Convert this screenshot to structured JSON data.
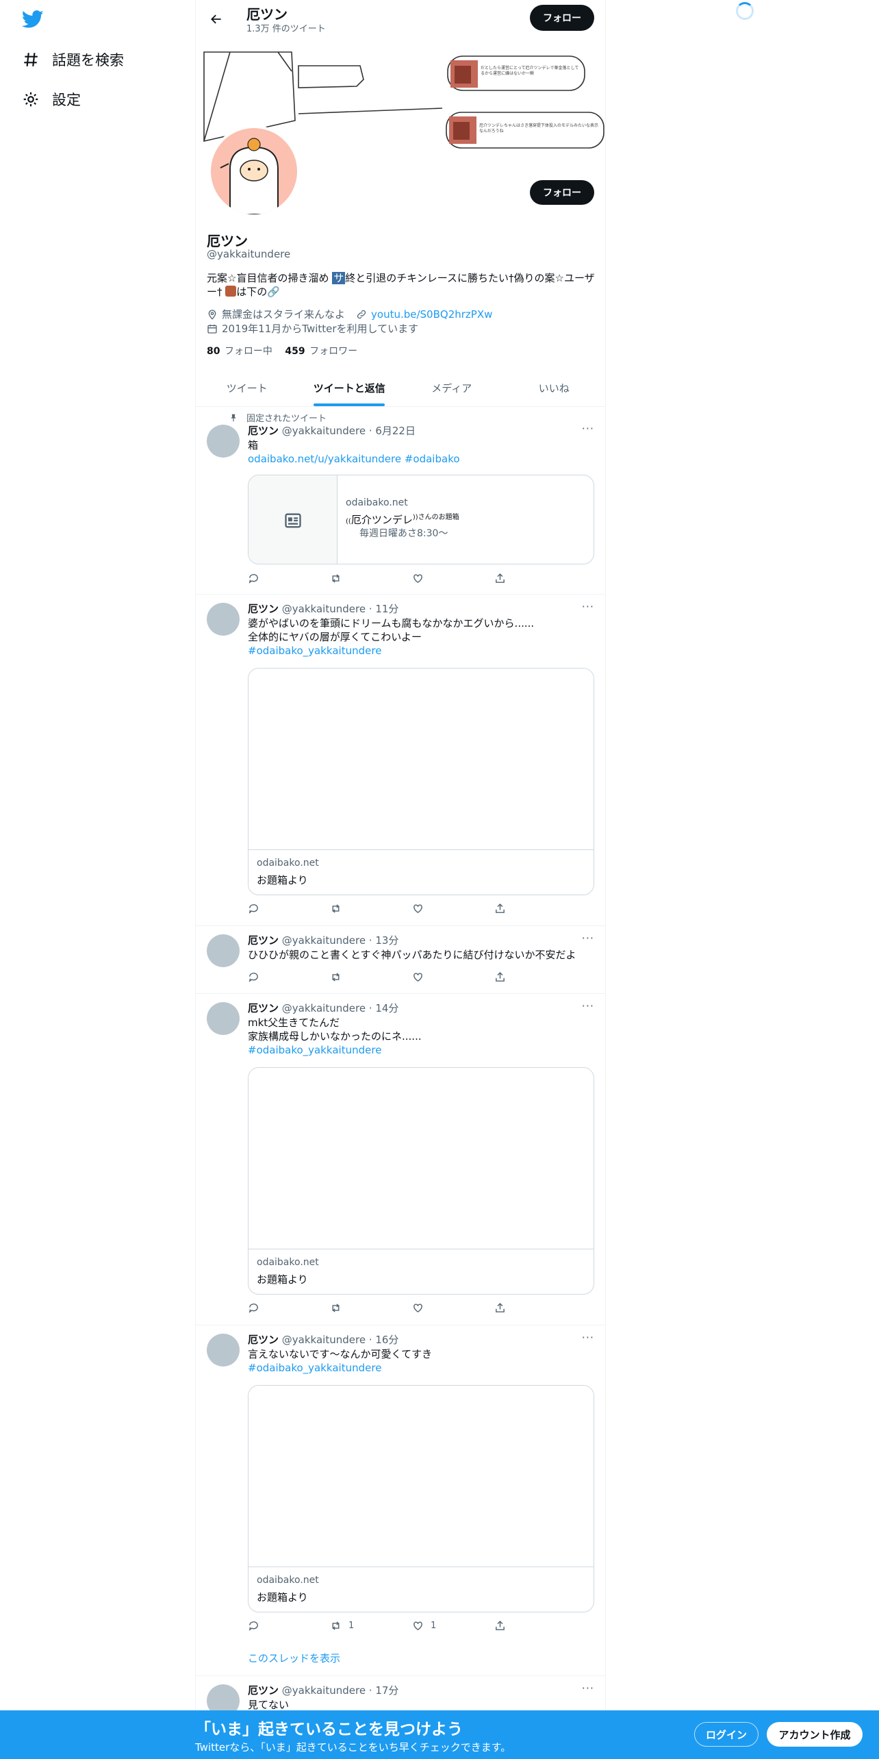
{
  "nav": {
    "items": [
      {
        "label": "話題を検索",
        "icon": "hashtag-icon"
      },
      {
        "label": "設定",
        "icon": "gear-icon"
      }
    ]
  },
  "header": {
    "name": "厄ツン",
    "tweet_count": "1.3万 件のツイート",
    "follow_label": "フォロー"
  },
  "profile": {
    "name": "厄ツン",
    "handle": "@yakkaitundere",
    "bio_before": "元案☆盲目信者の掃き溜め ",
    "bio_tag": "サ",
    "bio_after": "終と引退のチキンレースに勝ちたい†偽りの案☆ユーザー† ",
    "bio_end": "は下の🔗",
    "location": "無課金はスタライ来んなよ",
    "link": "youtu.be/S0BQ2hrzPXw",
    "joined": "2019年11月からTwitterを利用しています",
    "following_count": "80",
    "following_label": "フォロー中",
    "followers_count": "459",
    "followers_label": "フォロワー",
    "follow_label": "フォロー"
  },
  "banner": {
    "note1": "だとしたら運営にとって厄介ツンデレで華金落としてるから運営に嫌はないか一瞬",
    "note2": "厄介ツンデレちゃんはさき落穿提下体投入のモデルみたいな表示なんだろうね"
  },
  "tabs": [
    {
      "label": "ツイート",
      "active": false
    },
    {
      "label": "ツイートと返信",
      "active": true
    },
    {
      "label": "メディア",
      "active": false
    },
    {
      "label": "いいね",
      "active": false
    }
  ],
  "tweets": [
    {
      "pinned_label": "固定されたツイート",
      "name": "厄ツン",
      "meta": "@yakkaitundere · 6月22日",
      "line1": "箱",
      "link_text": "odaibako.net/u/yakkaitundere #odaibako",
      "card_domain": "odaibako.net",
      "card_title_pre": "((",
      "card_title_main": "厄介ツンデレ",
      "card_title_post": "))さんのお題箱",
      "card_desc": "毎週日曜あさ8:30〜"
    },
    {
      "name": "厄ツン",
      "meta": "@yakkaitundere · 11分",
      "line1": "婆がやばいのを筆頭にドリームも腐もなかなかエグいから......",
      "line2": "全体的にヤバの層が厚くてこわいよー",
      "hashtag": "#odaibako_yakkaitundere",
      "card_domain": "odaibako.net",
      "card_title": "お題箱より"
    },
    {
      "name": "厄ツン",
      "meta": "@yakkaitundere · 13分",
      "line1": "ひひひが親のこと書くとすぐ神パッパあたりに結び付けないか不安だよ"
    },
    {
      "name": "厄ツン",
      "meta": "@yakkaitundere · 14分",
      "line1": "mkt父生きてたんだ",
      "line2": "家族構成母しかいなかったのにネ......",
      "hashtag": "#odaibako_yakkaitundere",
      "card_domain": "odaibako.net",
      "card_title": "お題箱より"
    },
    {
      "name": "厄ツン",
      "meta": "@yakkaitundere · 16分",
      "line1": "言えないないです～なんか可愛くてすき",
      "hashtag": "#odaibako_yakkaitundere",
      "card_domain": "odaibako.net",
      "card_title": "お題箱より",
      "retweets": "1",
      "likes": "1",
      "thread_label": "このスレッドを表示"
    },
    {
      "name": "厄ツン",
      "meta": "@yakkaitundere · 17分",
      "line1": "見てない"
    }
  ],
  "bottom": {
    "title": "「いま」起きていることを見つけよう",
    "subtitle": "Twitterなら、「いま」起きていることをいち早くチェックできます。",
    "login": "ログイン",
    "signup": "アカウント作成"
  },
  "colors": {
    "accent": "#1d9bf0",
    "text": "#0f1419",
    "muted": "#536471"
  }
}
